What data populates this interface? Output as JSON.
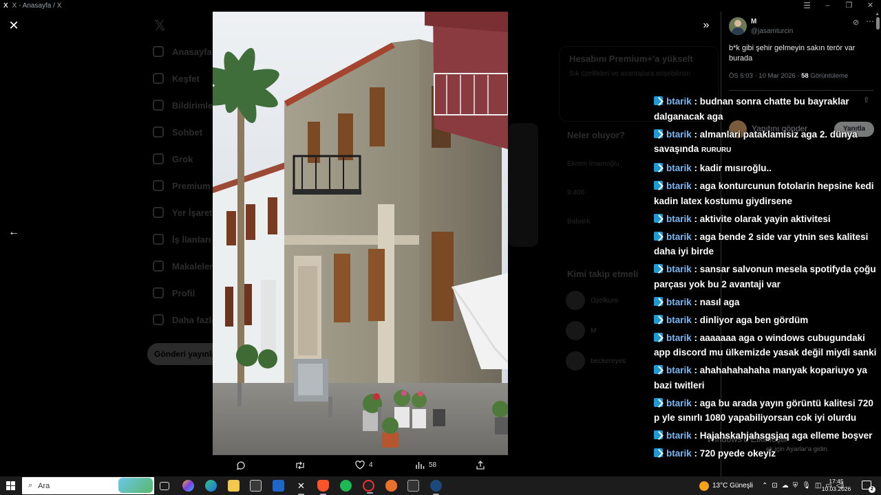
{
  "window": {
    "title": "X - Anasayfa / X",
    "app_letter": "X"
  },
  "background": {
    "nav_items": [
      "Anasayfa",
      "Keşfet",
      "Bildirimler",
      "Sohbet",
      "Grok",
      "Premium",
      "Yer İşaretleri",
      "İş İlanları",
      "Makaleler",
      "Profil",
      "Daha fazla"
    ],
    "post_button": "Gönderi yayınla",
    "premium_title": "Hesabını Premium+'a yükselt",
    "premium_desc": "Sık özellikleri ve avantajlara erişebilirsin",
    "trends_title": "Neler oluyor?",
    "trends": [
      "Ekrem İmamoğlu",
      "9.400",
      "Babalık"
    ],
    "follow_title": "Kimi takip etmeli",
    "follow": [
      "Ozelkuro",
      "M",
      "beckereyes"
    ]
  },
  "tweet": {
    "name": "M",
    "handle": "@jasamturcin",
    "text": "b*k gibi şehir gelmeyin sakın terör var burada",
    "time": "ÖS 5:03 · 10 Mar 2026 · ",
    "views_count": "58",
    "views_label": "Görüntüleme",
    "reply_placeholder": "Yanıtını gönder",
    "reply_button": "Yanıtla"
  },
  "actions": {
    "likes": "4",
    "views": "58"
  },
  "chat": [
    {
      "user": "btarik",
      "text": ": budnan sonra chatte bu bayraklar dalganacak aga"
    },
    {
      "user": "btarik",
      "text": ": almanlari pataklamisiz aga 2. dünya savaşında ",
      "small": "RURURU"
    },
    {
      "user": "btarik",
      "text": ": kadir mısıroğlu.."
    },
    {
      "user": "btarik",
      "text": ": aga konturcunun fotolarin hepsine kedi kadin latex kostumu giydirsene"
    },
    {
      "user": "btarik",
      "text": ": aktivite olarak yayin aktivitesi"
    },
    {
      "user": "btarik",
      "text": ": aga bende 2 side var ytnin ses kalitesi daha iyi birde"
    },
    {
      "user": "btarik",
      "text": ": sansar salvonun mesela spotifyda çoğu parçası yok bu 2 avantaji var"
    },
    {
      "user": "btarik",
      "text": ": nasıl aga"
    },
    {
      "user": "btarik",
      "text": ": dinliyor aga ben gördüm"
    },
    {
      "user": "btarik",
      "text": ": aaaaaaa aga o windows cubugundaki app discord mu ülkemizde yasak değil miydi sanki"
    },
    {
      "user": "btarik",
      "text": ": ahahahahahaha manyak kopariuyo ya bazi twitleri"
    },
    {
      "user": "btarik",
      "text": ": aga bu arada yayın görüntü kalitesi 720 p yle sınırlı 1080 yapabiliyorsan cok iyi olurdu"
    },
    {
      "user": "btarik",
      "text": ": Hajahskahjahsgsjaq aga elleme boşver"
    },
    {
      "user": "btarik",
      "text": ": 720 pyede okeyiz"
    }
  ],
  "watermark": {
    "line1": "Windows'u Etkinleştir",
    "line2": "ek için Ayarlar'a gidin."
  },
  "taskbar": {
    "search_placeholder": "Ara",
    "weather": "13°C  Güneşli",
    "time": "17:45",
    "date": "10.03.2026",
    "notifications": "2"
  },
  "colors": {
    "accent": "#1d9bf0",
    "chat_user": "#7ab8f5",
    "badge": "#1e9bd7"
  }
}
